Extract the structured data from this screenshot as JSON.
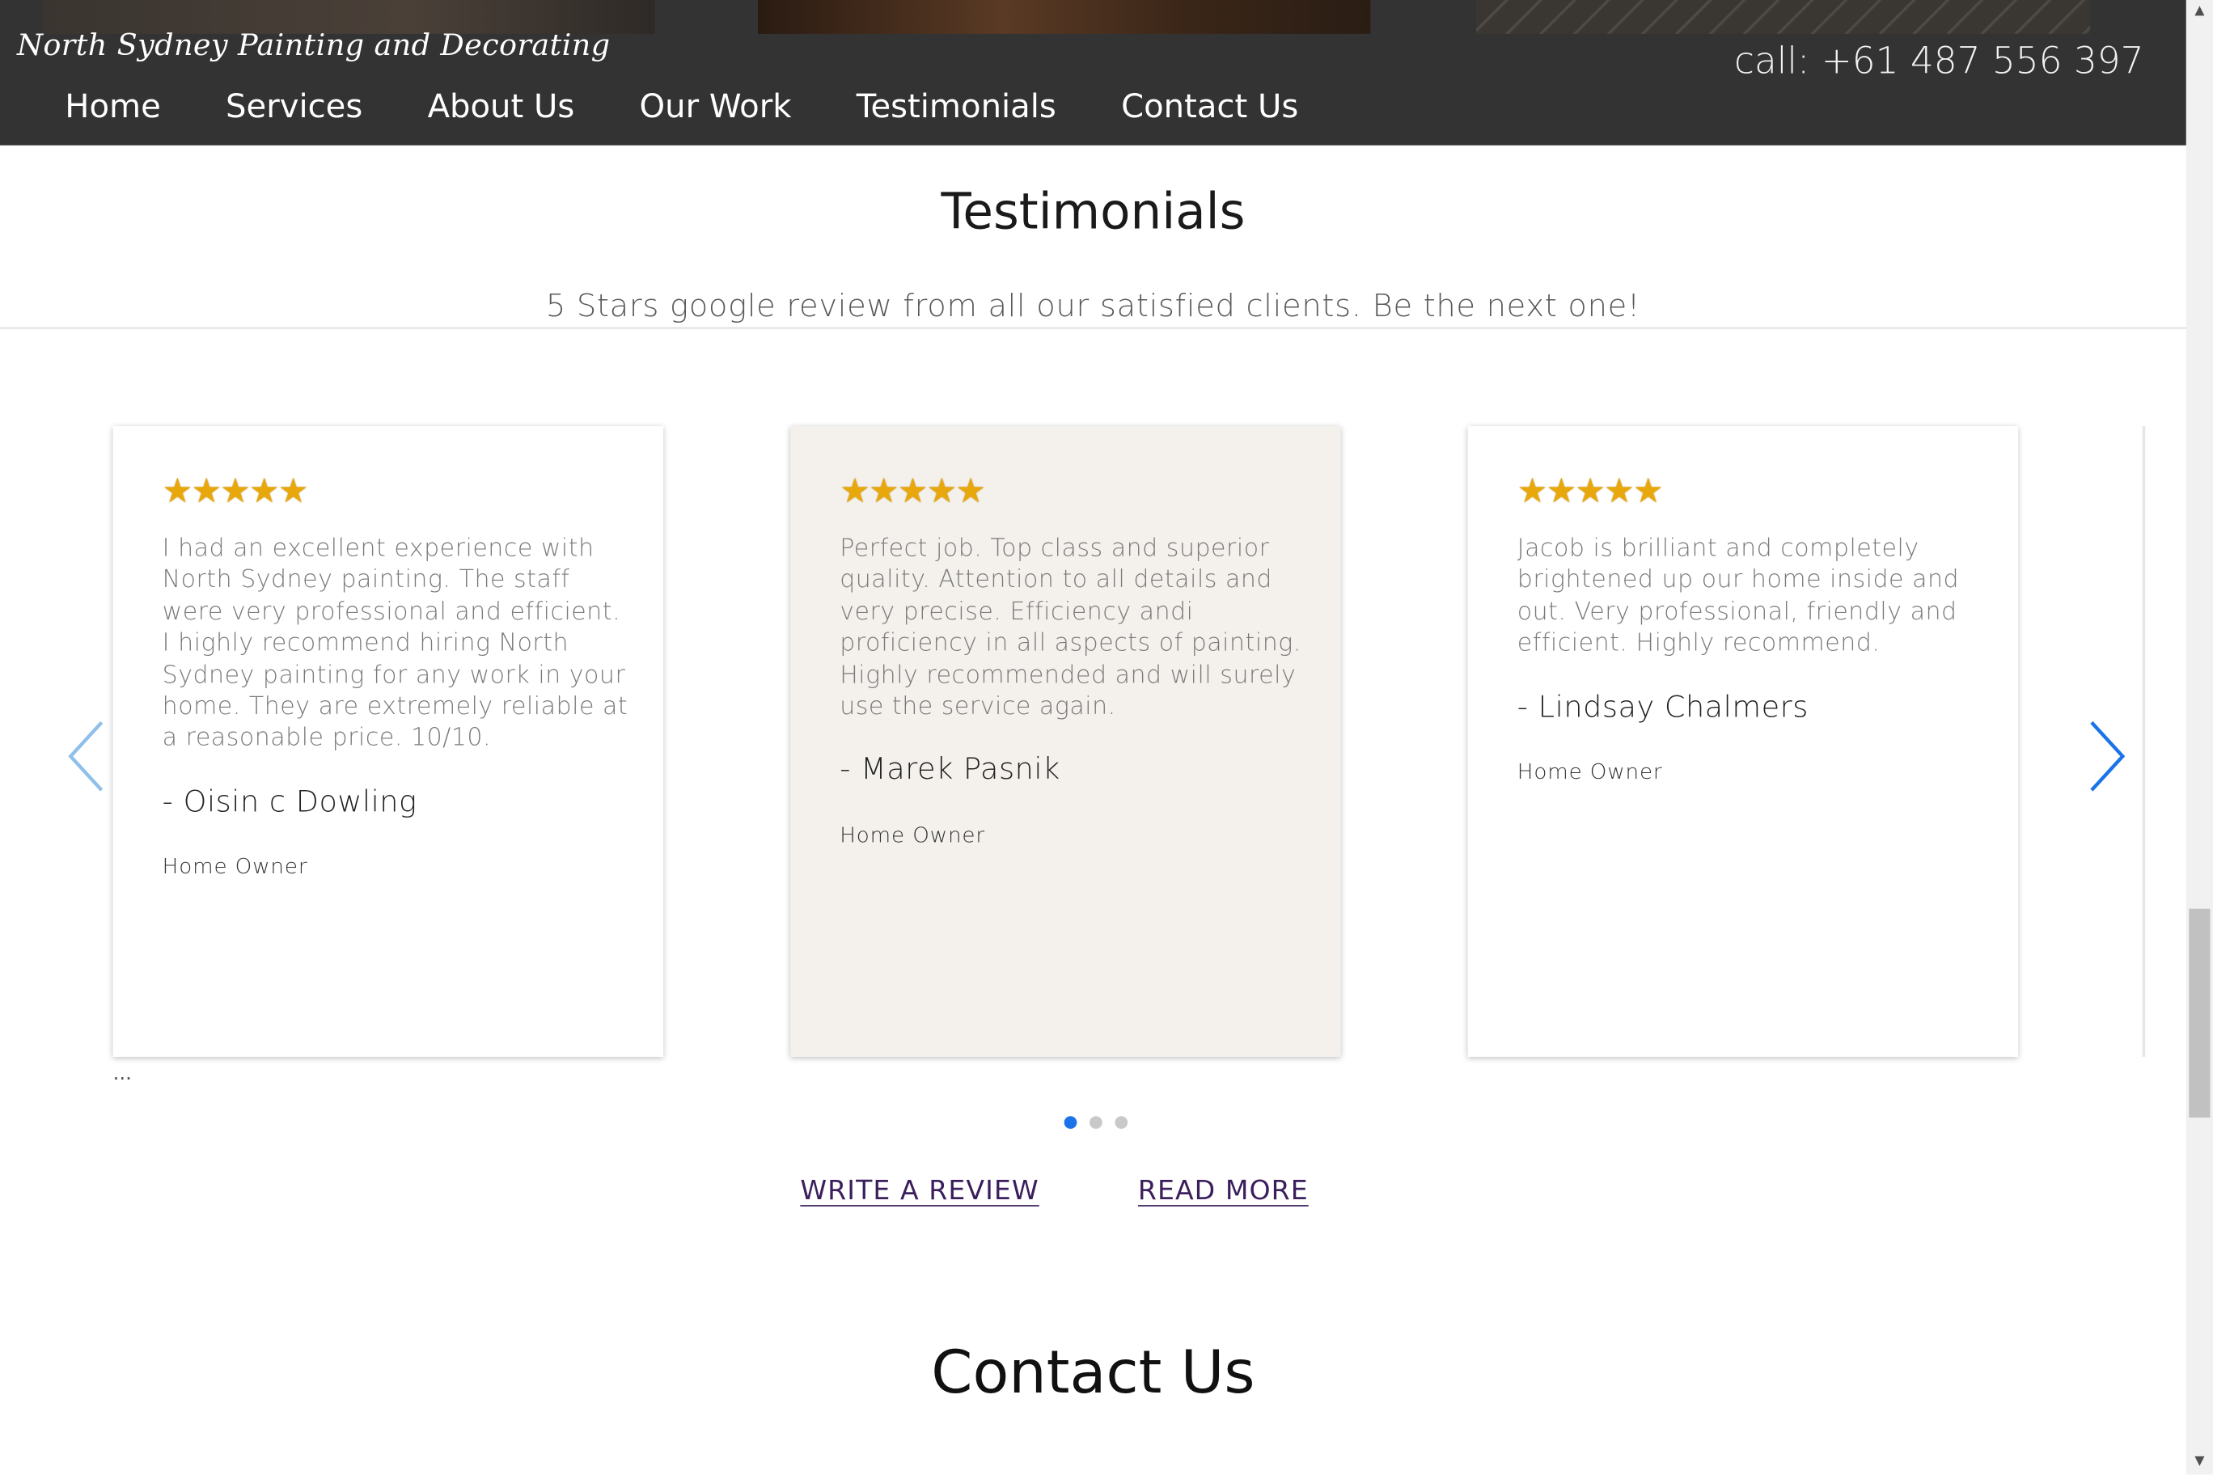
{
  "header": {
    "logo_text": "North Sydney Painting and Decorating",
    "phone": "call: +61 487 556 397",
    "nav": [
      "Home",
      "Services",
      "About Us",
      "Our Work",
      "Testimonials",
      "Contact Us"
    ]
  },
  "testimonials": {
    "title": "Testimonials",
    "subtitle": "5 Stars google review from all our satisfied clients. Be the next one!",
    "cards": [
      {
        "stars": "★★★★★",
        "rating": 5,
        "text": "I had an excellent experience with North Sydney painting. The staff were very professional and efficient. I highly recommend hiring North Sydney painting for any work in your home. They are extremely reliable at a reasonable price. 10/10.",
        "author": "- Oisin c Dowling",
        "role": "Home Owner"
      },
      {
        "stars": "★★★★★",
        "rating": 5,
        "text": "Perfect job. Top class and superior quality. Attention to all details and very precise. Efficiency andi proficiency in all aspects of painting. Highly recommended and will surely use the service again.",
        "author": "- Marek Pasnik",
        "role": "Home Owner"
      },
      {
        "stars": "★★★★★",
        "rating": 5,
        "text": "Jacob is brilliant and completely brightened up our home inside and out. Very professional, friendly and efficient. Highly recommend.",
        "author": "- Lindsay Chalmers",
        "role": "Home Owner"
      }
    ],
    "ellipsis": "...",
    "active_page": 1,
    "page_count": 3,
    "write_review": "WRITE A REVIEW",
    "read_more": "READ MORE"
  },
  "contact": {
    "title": "Contact Us"
  },
  "colors": {
    "header_bg": "#333333",
    "star": "#e8a80c",
    "arrow_left": "#90c0ea",
    "arrow_right": "#1a73e8",
    "dot_active": "#1a73e8",
    "link": "#3b1f5c",
    "featured_card_bg": "#f4f1ed"
  },
  "scrollbar": {
    "up_icon": "triangle-up",
    "down_icon": "triangle-down"
  }
}
